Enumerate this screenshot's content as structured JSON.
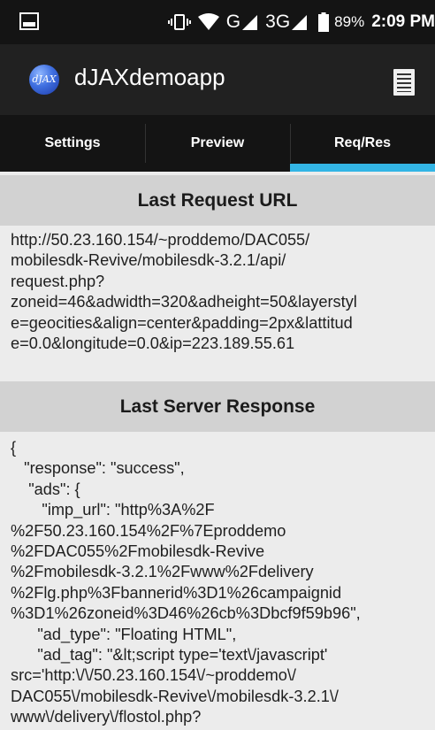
{
  "status_bar": {
    "network": "G",
    "network_secondary": "3G",
    "battery": "89%",
    "time": "2:09 PM"
  },
  "app_bar": {
    "logo_text": "dJAX",
    "title": "dJAXdemoapp"
  },
  "tabs": [
    {
      "label": "Settings",
      "active": false
    },
    {
      "label": "Preview",
      "active": false
    },
    {
      "label": "Req/Res",
      "active": true
    }
  ],
  "request": {
    "header": "Last Request URL",
    "url": "http://50.23.160.154/~proddemo/DAC055/\nmobilesdk-Revive/mobilesdk-3.2.1/api/\nrequest.php?\nzoneid=46&adwidth=320&adheight=50&layerstyl\ne=geocities&align=center&padding=2px&lattitud\ne=0.0&longitude=0.0&ip=223.189.55.61"
  },
  "response": {
    "header": "Last Server Response",
    "body": "{\n   \"response\": \"success\",\n    \"ads\": {\n       \"imp_url\": \"http%3A%2F\n%2F50.23.160.154%2F%7Eproddemo\n%2FDAC055%2Fmobilesdk-Revive\n%2Fmobilesdk-3.2.1%2Fwww%2Fdelivery\n%2Flg.php%3Fbannerid%3D1%26campaignid\n%3D1%26zoneid%3D46%26cb%3Dbcf9f59b96\",\n      \"ad_type\": \"Floating HTML\",\n      \"ad_tag\": \"&lt;script type='text\\/javascript'\nsrc='http:\\/\\/50.23.160.154\\/~proddemo\\/\nDAC055\\/mobilesdk-Revive\\/mobilesdk-3.2.1\\/\nwww\\/delivery\\/flostol.php?"
  },
  "colors": {
    "status_bar": "#141414",
    "app_bar": "#212121",
    "tab_indicator": "#33b5e5",
    "section_header": "#d2d2d2",
    "background": "#ececec"
  }
}
